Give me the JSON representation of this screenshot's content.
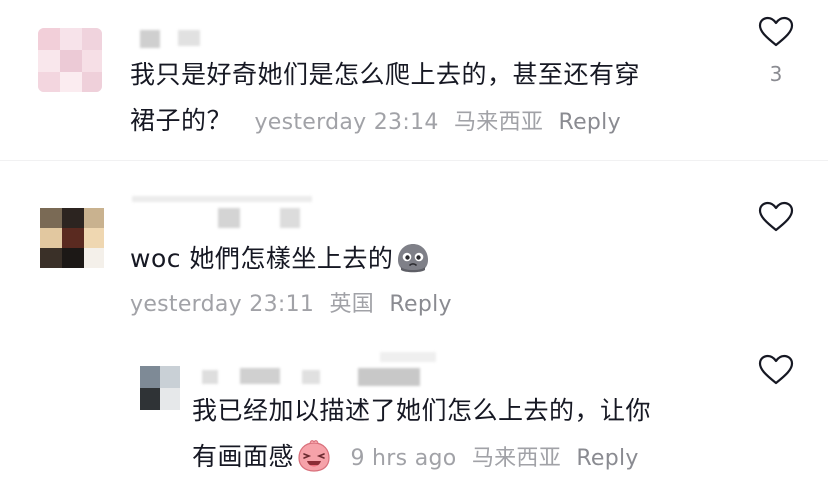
{
  "comments": [
    {
      "text_line1": "我只是好奇她们是怎么爬上去的，甚至还有穿",
      "text_line2": "裙子的？",
      "time": "yesterday 23:14",
      "location": "马来西亚",
      "reply_label": "Reply",
      "like_count": "3",
      "heart_icon": "heart-outline-icon"
    },
    {
      "text": "woc 她們怎樣坐上去的",
      "emoji": "crying-face-emoji",
      "time": "yesterday 23:11",
      "location": "英国",
      "reply_label": "Reply",
      "heart_icon": "heart-outline-icon"
    },
    {
      "text_line1": "我已经加以描述了她们怎么上去的，让你",
      "text_line2": "有画面感",
      "emoji": "pink-laughing-emoji",
      "time": "9 hrs ago",
      "location": "马来西亚",
      "reply_label": "Reply",
      "heart_icon": "heart-outline-icon"
    }
  ],
  "colors": {
    "text": "#161823",
    "meta": "#a1a2a7",
    "icon": "#8a8b91"
  }
}
